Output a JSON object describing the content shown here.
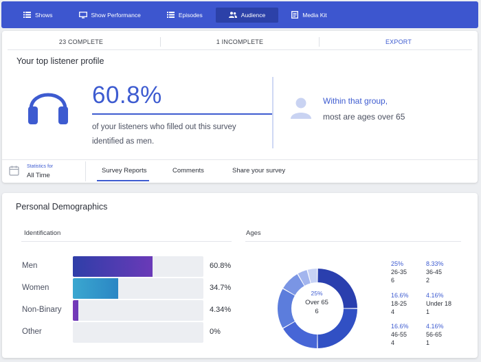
{
  "nav": {
    "items": [
      {
        "label": "Shows",
        "icon": "list-icon"
      },
      {
        "label": "Show Performance",
        "icon": "monitor-icon"
      },
      {
        "label": "Episodes",
        "icon": "list-icon"
      },
      {
        "label": "Audience",
        "icon": "people-icon",
        "active": true
      },
      {
        "label": "Media Kit",
        "icon": "document-icon"
      }
    ]
  },
  "stats": {
    "complete": "23 COMPLETE",
    "incomplete": "1 INCOMPLETE",
    "export": "EXPORT"
  },
  "profile": {
    "title": "Your top listener profile",
    "percent": "60.8%",
    "description": "of your listeners who filled out this survey identified as men.",
    "group_heading": "Within that group,",
    "group_detail": "most are ages over 65"
  },
  "footer": {
    "stats_for": "Statistics for",
    "period": "All Time",
    "tabs": [
      "Survey Reports",
      "Comments",
      "Share your survey"
    ],
    "active_tab": "Survey Reports"
  },
  "demographics": {
    "title": "Personal Demographics",
    "identification": {
      "heading": "Identification",
      "rows": [
        {
          "label": "Men",
          "value": "60.8%",
          "fraction": 0.608,
          "color_start": "#2f3ea8",
          "color_end": "#6a3ab8"
        },
        {
          "label": "Women",
          "value": "34.7%",
          "fraction": 0.347,
          "color_start": "#3aa7d0",
          "color_end": "#2b86c4"
        },
        {
          "label": "Non-Binary",
          "value": "4.34%",
          "fraction": 0.0434,
          "color_start": "#7a3ab8",
          "color_end": "#6a3ab8"
        },
        {
          "label": "Other",
          "value": "0%",
          "fraction": 0,
          "color_start": "#eceef2",
          "color_end": "#eceef2"
        }
      ]
    },
    "ages": {
      "heading": "Ages",
      "center": {
        "percent": "25%",
        "group": "Over 65",
        "count": "6"
      },
      "segments": [
        {
          "group": "Over 65",
          "fraction": 0.25,
          "color": "#2a3fae"
        },
        {
          "group": "26-35",
          "fraction": 0.25,
          "color": "#3150c4"
        },
        {
          "group": "46-55",
          "fraction": 0.1666,
          "color": "#4766d6"
        },
        {
          "group": "18-25",
          "fraction": 0.1666,
          "color": "#5c7ddc"
        },
        {
          "group": "36-45",
          "fraction": 0.0833,
          "color": "#7a95e4"
        },
        {
          "group": "56-65",
          "fraction": 0.0416,
          "color": "#a3b5ee"
        },
        {
          "group": "Under 18",
          "fraction": 0.0416,
          "color": "#c7d2f5"
        }
      ],
      "legend": [
        {
          "percent": "25%",
          "group": "26-35",
          "count": "6"
        },
        {
          "percent": "8.33%",
          "group": "36-45",
          "count": "2"
        },
        {
          "percent": "16.6%",
          "group": "18-25",
          "count": "4"
        },
        {
          "percent": "4.16%",
          "group": "Under 18",
          "count": "1"
        },
        {
          "percent": "16.6%",
          "group": "46-55",
          "count": "4"
        },
        {
          "percent": "4.16%",
          "group": "56-65",
          "count": "1"
        }
      ]
    }
  }
}
